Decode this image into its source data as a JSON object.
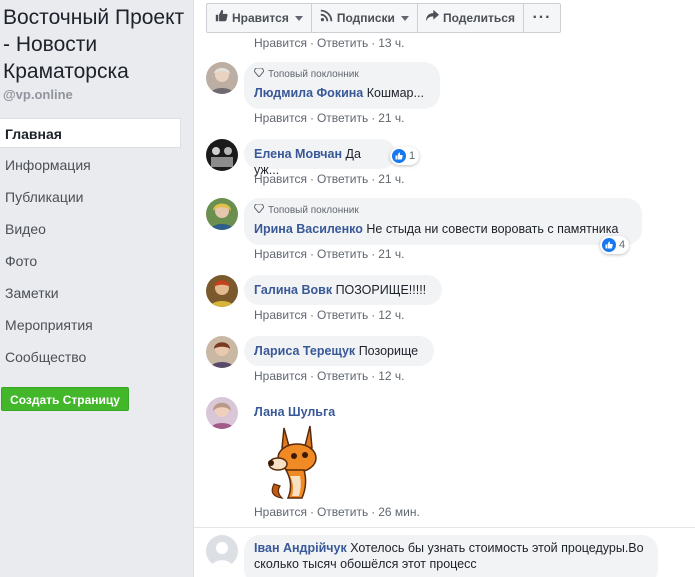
{
  "page": {
    "title": "Восточный Проект - Новости Краматорска",
    "handle": "@vp.online"
  },
  "nav": {
    "items": [
      "Главная",
      "Информация",
      "Публикации",
      "Видео",
      "Фото",
      "Заметки",
      "Мероприятия",
      "Сообщество"
    ],
    "active": "Главная",
    "create_page": "Создать Страницу"
  },
  "actionbar": {
    "like": "Нравится",
    "follow": "Подписки",
    "share": "Поделиться",
    "more": "···"
  },
  "comment_actions": {
    "like": "Нравится",
    "reply": "Ответить"
  },
  "top_partial": {
    "time": "13 ч."
  },
  "top_fan_label": "Топовый поклонник",
  "comments": [
    {
      "author": "Людмила Фокина",
      "text": "Кошмар...",
      "time": "21 ч.",
      "top_fan": true
    },
    {
      "author": "Елена Мовчан",
      "text": "Да уж...",
      "time": "21 ч.",
      "reactions": "1"
    },
    {
      "author": "Ирина Василенко",
      "text": "Не стыда ни совести воровать с памятника",
      "time": "21 ч.",
      "top_fan": true,
      "reactions": "4"
    },
    {
      "author": "Галина Вовк",
      "text": "ПОЗОРИЩЕ!!!!!",
      "time": "12 ч."
    },
    {
      "author": "Лариса Терещук",
      "text": "Позорище",
      "time": "12 ч."
    },
    {
      "author": "Лана Шульга",
      "text": "",
      "time": "26 мин.",
      "sticker": "fox-sticker"
    },
    {
      "author": "Іван Андрійчук",
      "text": "Хотелось бы узнать стоимость этой процедуры.Во сколько тысяч обошёлся этот процесс",
      "time": ""
    }
  ],
  "colors": {
    "link": "#385898",
    "bubble": "#f2f3f5",
    "green": "#42b72a",
    "like": "#1877f2"
  }
}
